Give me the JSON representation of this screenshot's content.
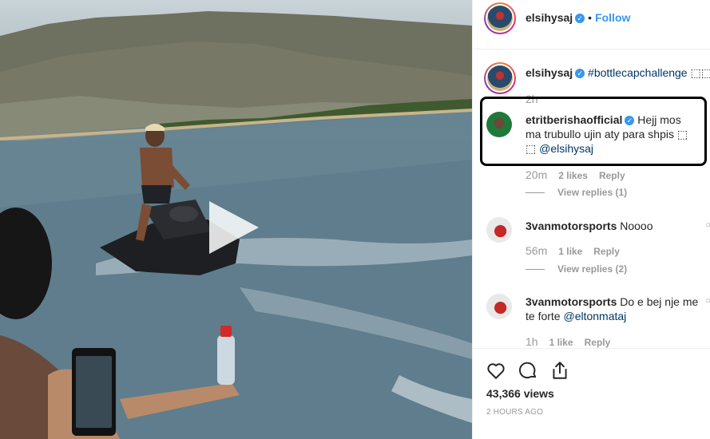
{
  "post": {
    "author": "elsihysaj",
    "follow_label": "Follow",
    "separator": "•"
  },
  "comments": [
    {
      "user": "elsihysaj",
      "verified": true,
      "text": "#bottlecapchallenge",
      "emoji": "⬚⬚⬚",
      "time": "2h"
    },
    {
      "user": "etritberishaofficial",
      "verified": true,
      "text_line1": "Hejj mos",
      "text_line2": "ma trubullo ujin aty para shpis",
      "emoji1": "⬚",
      "emoji2": "⬚",
      "mention": "@elsihysaj",
      "time": "20m",
      "likes": "2 likes",
      "reply": "Reply",
      "view_replies": "View replies (1)"
    },
    {
      "user": "3vanmotorsports",
      "verified": false,
      "text": "Noooo",
      "time": "56m",
      "likes": "1 like",
      "reply": "Reply",
      "view_replies": "View replies (2)"
    },
    {
      "user": "3vanmotorsports",
      "verified": false,
      "text_line1": "Do e bej nje me",
      "text_line2": "te forte",
      "mention": "@eltonmataj",
      "time": "1h",
      "likes": "1 like",
      "reply": "Reply"
    }
  ],
  "stats": {
    "views": "43,366 views",
    "posted_ago": "2 HOURS AGO"
  },
  "icons": {
    "like": "heart-icon",
    "comment": "comment-icon",
    "share": "share-icon",
    "verified": "verified-badge-icon",
    "play": "play-icon"
  },
  "colors": {
    "accent": "#3897f0",
    "link": "#003569",
    "muted": "#999999",
    "highlight_box": "#000000"
  }
}
